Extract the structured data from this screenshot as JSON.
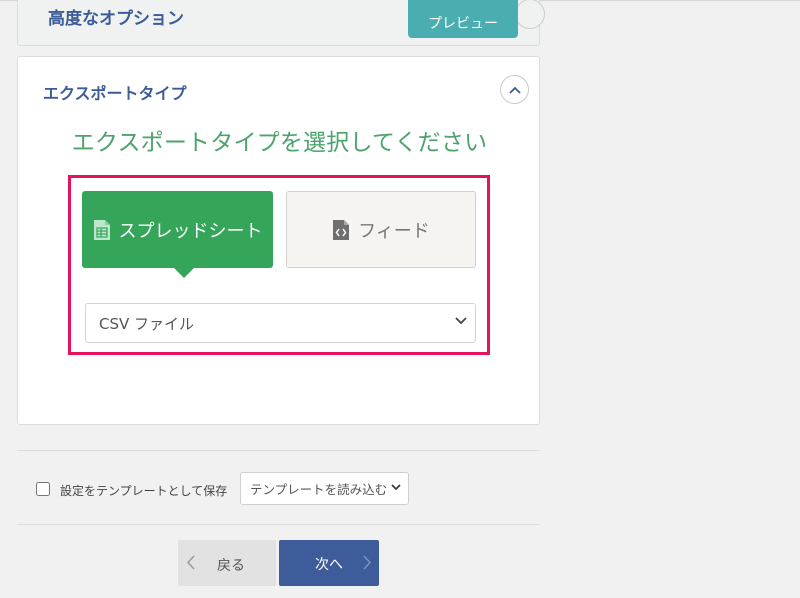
{
  "advanced": {
    "title": "高度なオプション",
    "preview_label": "プレビュー"
  },
  "export": {
    "heading": "エクスポートタイプ",
    "prompt": "エクスポートタイプを選択してください",
    "types": [
      {
        "label": "スプレッドシート",
        "icon": "spreadsheet-icon",
        "selected": true
      },
      {
        "label": "フィード",
        "icon": "code-file-icon",
        "selected": false
      }
    ],
    "file_type": "CSV ファイル"
  },
  "template": {
    "save_label": "設定をテンプレートとして保存",
    "load_label": "テンプレートを読み込む"
  },
  "nav": {
    "back_label": "戻る",
    "next_label": "次へ"
  },
  "colors": {
    "accent_blue": "#3e5c99",
    "green": "#35a55a",
    "teal": "#4aadb0",
    "highlight": "#e5135d"
  }
}
